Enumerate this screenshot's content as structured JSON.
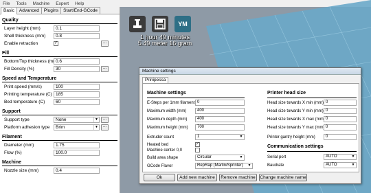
{
  "menu": [
    "File",
    "Tools",
    "Machine",
    "Expert",
    "Help"
  ],
  "tabs": [
    "Basic",
    "Advanced",
    "Plugins",
    "Start/End-GCode"
  ],
  "settings": {
    "quality": {
      "title": "Quality",
      "layer_height": {
        "label": "Layer height (mm)",
        "value": "0.1"
      },
      "shell_thickness": {
        "label": "Shell thickness (mm)",
        "value": "0.8"
      },
      "retraction": {
        "label": "Enable retraction",
        "checked": "✓",
        "more": "..."
      }
    },
    "fill": {
      "title": "Fill",
      "bottom_top": {
        "label": "Bottom/Top thickness (mm)",
        "value": "0.6"
      },
      "density": {
        "label": "Fill Density (%)",
        "value": "30",
        "more": "..."
      }
    },
    "speed": {
      "title": "Speed and Temperature",
      "print_speed": {
        "label": "Print speed (mm/s)",
        "value": "100"
      },
      "print_temp": {
        "label": "Printing temperature (C)",
        "value": "185"
      },
      "bed_temp": {
        "label": "Bed temperature (C)",
        "value": "60"
      }
    },
    "support": {
      "title": "Support",
      "type": {
        "label": "Support type",
        "value": "None",
        "more": "..."
      },
      "adhesion": {
        "label": "Platform adhesion type",
        "value": "Brim",
        "more": "..."
      }
    },
    "filament": {
      "title": "Filament",
      "diameter": {
        "label": "Diameter (mm)",
        "value": "1.75"
      },
      "flow": {
        "label": "Flow (%)",
        "value": "100.0"
      }
    },
    "machine": {
      "title": "Machine",
      "nozzle": {
        "label": "Nozzle size (mm)",
        "value": "0.4"
      }
    }
  },
  "toolbar": {
    "ym_label": "YM"
  },
  "print_info": {
    "time": "1 hour 49 minutes",
    "material": "5.49 meter 16 gram"
  },
  "dialog": {
    "title": "Machine settings",
    "tab": "Prinipessa",
    "machine": {
      "title": "Machine settings",
      "esteps": {
        "label": "E-Steps per 1mm filament",
        "value": "0"
      },
      "max_width": {
        "label": "Maximum width (mm)",
        "value": "400"
      },
      "max_depth": {
        "label": "Maximum depth (mm)",
        "value": "400"
      },
      "max_height": {
        "label": "Maximum height (mm)",
        "value": "700"
      },
      "extruder_count": {
        "label": "Extruder count",
        "value": "1"
      },
      "heated_bed": {
        "label": "Heated bed",
        "checked": "✓"
      },
      "center": {
        "label": "Machine center 0,0",
        "checked": ""
      },
      "build_shape": {
        "label": "Build area shape",
        "value": "Circular"
      },
      "gcode_flavor": {
        "label": "GCode Flavor",
        "value": "RepRap (Marlin/Sprinter)"
      }
    },
    "head": {
      "title": "Printer head size",
      "xmin": {
        "label": "Head size towards X min (mm)",
        "value": "0"
      },
      "ymin": {
        "label": "Head size towards Y min (mm)",
        "value": "0"
      },
      "xmax": {
        "label": "Head size towards X max (mm)",
        "value": "0"
      },
      "ymax": {
        "label": "Head size towards Y max (mm)",
        "value": "0"
      },
      "gantry": {
        "label": "Printer gantry height (mm)",
        "value": "0"
      }
    },
    "comm": {
      "title": "Communication settings",
      "port": {
        "label": "Serial port",
        "value": "AUTO"
      },
      "baud": {
        "label": "Baudrate",
        "value": "AUTO"
      }
    },
    "buttons": {
      "ok": "Ok",
      "add": "Add new machine",
      "remove": "Remove machine",
      "rename": "Change machine name"
    }
  },
  "colors": {
    "viewport": "#8e9aa6",
    "platform": "#6aa9c9",
    "accent": "#2e6f86"
  }
}
